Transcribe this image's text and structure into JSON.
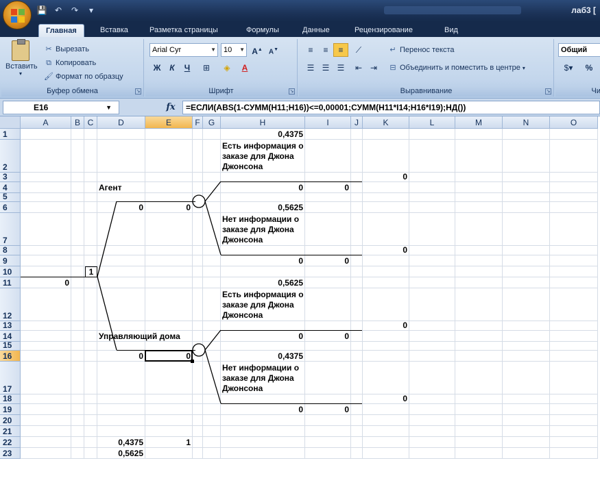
{
  "titlebar": {
    "doc_title": "лаб3 ["
  },
  "tabs": [
    "Главная",
    "Вставка",
    "Разметка страницы",
    "Формулы",
    "Данные",
    "Рецензирование",
    "Вид"
  ],
  "ribbon": {
    "clipboard": {
      "paste": "Вставить",
      "cut": "Вырезать",
      "copy": "Копировать",
      "format_painter": "Формат по образцу",
      "label": "Буфер обмена"
    },
    "font": {
      "name": "Arial Cyr",
      "size": "10",
      "label": "Шрифт",
      "bold": "Ж",
      "italic": "К",
      "underline": "Ч"
    },
    "alignment": {
      "wrap": "Перенос текста",
      "merge": "Объединить и поместить в центре",
      "label": "Выравнивание"
    },
    "number": {
      "format": "Общий",
      "label": "Чи",
      "percent": "%"
    }
  },
  "formula_bar": {
    "name_box": "E16",
    "formula": "=ЕСЛИ(ABS(1-СУММ(H11;H16))<=0,00001;СУММ(H11*I14;H16*I19);НД())"
  },
  "columns": [
    "A",
    "B",
    "C",
    "D",
    "E",
    "F",
    "G",
    "H",
    "I",
    "J",
    "K",
    "L",
    "M",
    "N",
    "O"
  ],
  "selected_column": "E",
  "rows": [
    "1",
    "2",
    "3",
    "4",
    "5",
    "6",
    "7",
    "8",
    "9",
    "10",
    "11",
    "12",
    "13",
    "14",
    "15",
    "16",
    "17",
    "18",
    "19",
    "20",
    "21",
    "22",
    "23"
  ],
  "selected_row": "16",
  "cells": {
    "H1": "0,4375",
    "H2": "Есть информация о заказе для Джона Джонсона",
    "K3": "0",
    "D4": "Агент",
    "H4": "0",
    "I4": "0",
    "D6": "0",
    "E6": "0",
    "H6": "0,5625",
    "H7": "Нет информации о заказе для Джона Джонсона",
    "K8": "0",
    "H9": "0",
    "I9": "0",
    "C10": "1",
    "A11": "0",
    "H11": "0,5625",
    "H12": "Есть информация о заказе для Джона Джонсона",
    "K13": "0",
    "D14": "Управляющий дома",
    "H14": "0",
    "I14": "0",
    "D16": "0",
    "E16": "0",
    "H16": "0,4375",
    "H17": "Нет информации о заказе для Джона Джонсона",
    "K18": "0",
    "H19": "0",
    "I19": "0",
    "D22": "0,4375",
    "E22": "1",
    "D23": "0,5625"
  }
}
